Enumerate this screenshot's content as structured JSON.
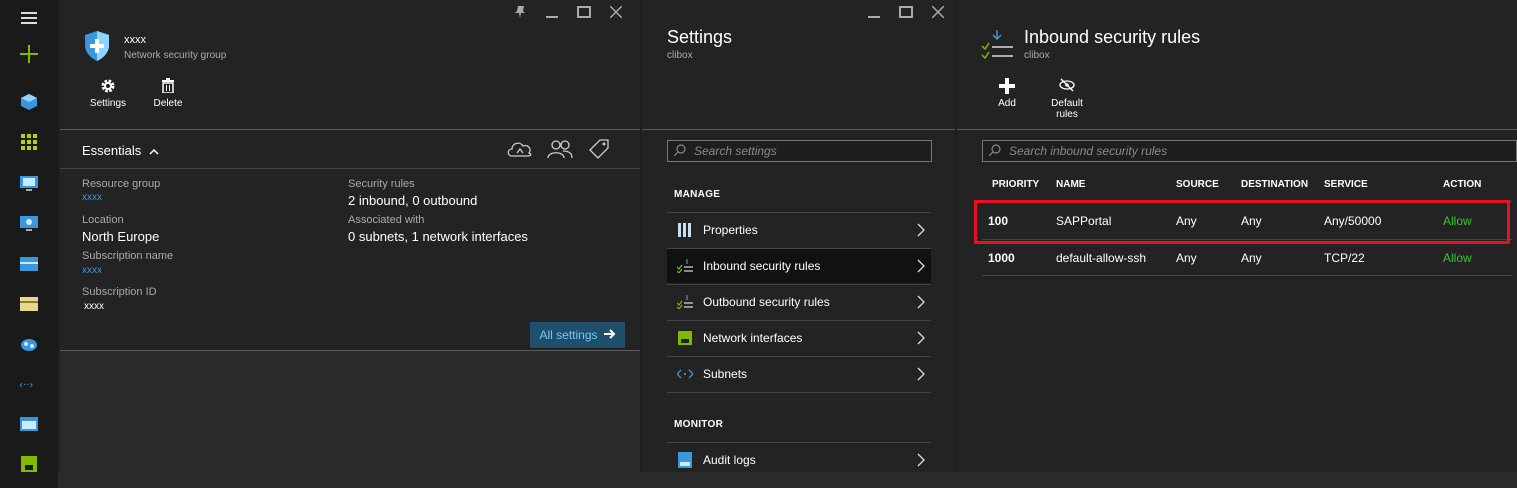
{
  "leftnav": {
    "items": [
      {
        "icon": "hamburger-menu-icon"
      },
      {
        "icon": "new-plus-icon"
      },
      {
        "icon": "resource-cube-icon"
      },
      {
        "icon": "dashboard-grid-icon"
      },
      {
        "icon": "virtual-machine-icon"
      },
      {
        "icon": "cloud-service-icon"
      },
      {
        "icon": "storage-icon"
      },
      {
        "icon": "subscription-icon"
      },
      {
        "icon": "app-service-icon"
      },
      {
        "icon": "virtual-network-icon"
      },
      {
        "icon": "monitor-icon"
      },
      {
        "icon": "network-interface-icon"
      }
    ]
  },
  "blade1": {
    "title": "xxxx",
    "subtitle": "Network security group",
    "commands": {
      "settings": "Settings",
      "delete": "Delete"
    },
    "essentials_label": "Essentials",
    "fields": {
      "resource_group_label": "Resource group",
      "resource_group_value": "xxxx",
      "location_label": "Location",
      "location_value": "North Europe",
      "subscription_name_label": "Subscription name",
      "subscription_name_value": "xxxx",
      "subscription_id_label": "Subscription ID",
      "subscription_id_value": "xxxx",
      "security_rules_label": "Security rules",
      "security_rules_value": "2 inbound, 0 outbound",
      "associated_label": "Associated with",
      "associated_value": "0 subnets, 1 network interfaces"
    },
    "all_settings": "All settings"
  },
  "blade2": {
    "title": "Settings",
    "subtitle": "clibox",
    "search_placeholder": "Search settings",
    "manage_header": "MANAGE",
    "manage_items": [
      {
        "label": "Properties",
        "icon": "properties-icon"
      },
      {
        "label": "Inbound security rules",
        "icon": "inbound-rules-icon"
      },
      {
        "label": "Outbound security rules",
        "icon": "outbound-rules-icon"
      },
      {
        "label": "Network interfaces",
        "icon": "network-interface-icon"
      },
      {
        "label": "Subnets",
        "icon": "subnets-icon"
      }
    ],
    "monitor_header": "MONITOR",
    "monitor_items": [
      {
        "label": "Audit logs",
        "icon": "audit-logs-icon"
      }
    ]
  },
  "blade3": {
    "title": "Inbound security rules",
    "subtitle": "clibox",
    "commands": {
      "add": "Add",
      "default_rules_line1": "Default",
      "default_rules_line2": "rules"
    },
    "search_placeholder": "Search inbound security rules",
    "columns": [
      "PRIORITY",
      "NAME",
      "SOURCE",
      "DESTINATION",
      "SERVICE",
      "ACTION"
    ],
    "rows": [
      {
        "priority": "100",
        "name": "SAPPortal",
        "source": "Any",
        "destination": "Any",
        "service": "Any/50000",
        "action": "Allow"
      },
      {
        "priority": "1000",
        "name": "default-allow-ssh",
        "source": "Any",
        "destination": "Any",
        "service": "TCP/22",
        "action": "Allow"
      }
    ]
  },
  "colors": {
    "accent_green": "#35c635",
    "link_blue": "#3a96dd",
    "highlight_red": "#e81123"
  }
}
